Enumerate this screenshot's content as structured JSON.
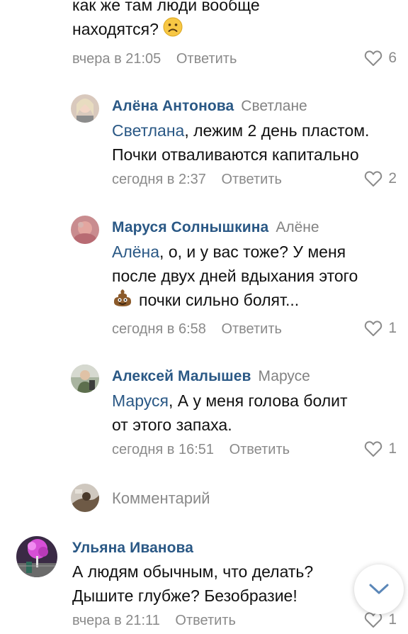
{
  "comments": [
    {
      "text_lines": [
        "как же там люди вообще",
        "находятся?"
      ],
      "time": "вчера в 21:05",
      "reply_label": "Ответить",
      "likes": "6"
    },
    {
      "author": "Алёна Антонова",
      "reply_to": "Светлане",
      "mention": "Светлана",
      "text_lines": [
        ", лежим 2 день пластом.",
        "Почки отваливаются капитально"
      ],
      "time": "сегодня в 2:37",
      "reply_label": "Ответить",
      "likes": "2"
    },
    {
      "author": "Маруся Солнышкина",
      "reply_to": "Алёне",
      "mention": "Алёна",
      "text_lines": [
        ", о, и у вас тоже? У меня",
        "после двух дней вдыхания этого",
        "почки сильно болят..."
      ],
      "time": "сегодня в 6:58",
      "reply_label": "Ответить",
      "likes": "1"
    },
    {
      "author": "Алексей Малышев",
      "reply_to": "Марусе",
      "mention": "Маруся",
      "text_lines": [
        ", А у меня голова болит",
        "от этого запаха."
      ],
      "time": "сегодня в 16:51",
      "reply_label": "Ответить",
      "likes": "1"
    },
    {
      "author": "Ульяна Иванова",
      "text_lines": [
        "А людям обычным, что делать?",
        "Дышите глубже? Безобразие!"
      ],
      "time": "вчера в 21:11",
      "reply_label": "Ответить",
      "likes": "1"
    }
  ],
  "reply_input": {
    "placeholder": "Комментарий"
  },
  "colors": {
    "link": "#2a5885",
    "muted": "#8a8a8a"
  }
}
